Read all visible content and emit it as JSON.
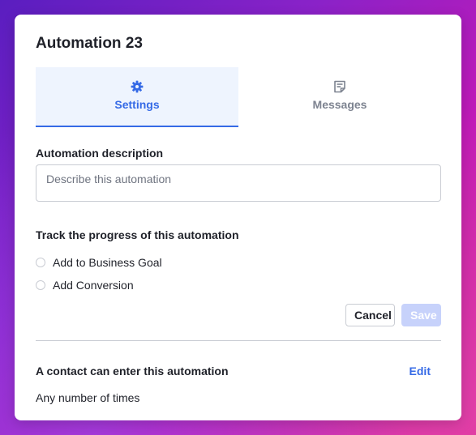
{
  "modal": {
    "title": "Automation 23"
  },
  "tabs": [
    {
      "label": "Settings",
      "icon": "gear-icon",
      "active": true
    },
    {
      "label": "Messages",
      "icon": "document-icon",
      "active": false
    }
  ],
  "description": {
    "label": "Automation description",
    "placeholder": "Describe this automation",
    "value": ""
  },
  "progress": {
    "label": "Track the progress of this automation",
    "options": [
      {
        "label": "Add to Business Goal",
        "selected": false
      },
      {
        "label": "Add Conversion",
        "selected": false
      }
    ]
  },
  "actions": {
    "cancel_label": "Cancel",
    "save_label": "Save"
  },
  "entry": {
    "label": "A contact can enter this automation",
    "edit_label": "Edit",
    "value": "Any number of times"
  },
  "colors": {
    "accent": "#356ae6",
    "active_tab_bg": "#eef4fe",
    "save_disabled_bg": "#c7d2fb",
    "text": "#1f2129",
    "muted": "#7d8390",
    "border": "#c9ccd3"
  }
}
